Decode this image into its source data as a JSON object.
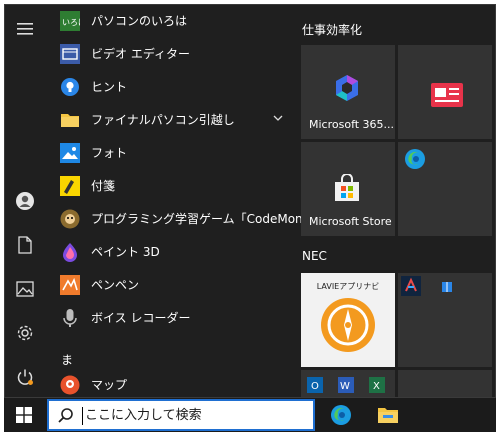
{
  "apps": [
    {
      "label": "パソコンのいろは"
    },
    {
      "label": "ビデオ エディター"
    },
    {
      "label": "ヒント"
    },
    {
      "label": "ファイナルパソコン引越し"
    },
    {
      "label": "フォト"
    },
    {
      "label": "付箋"
    },
    {
      "label": "プログラミング学習ゲーム「CodeMonkey（…"
    },
    {
      "label": "ペイント 3D"
    },
    {
      "label": "ペンペン"
    },
    {
      "label": "ボイス レコーダー"
    },
    {
      "label": "マップ"
    }
  ],
  "section_letter": "ま",
  "tile_groups": [
    {
      "title": "仕事効率化"
    },
    {
      "title": "NEC"
    }
  ],
  "tiles": {
    "microsoft365": "Microsoft 365...",
    "store": "Microsoft Store",
    "lavie": "LAVIEアプリナビ"
  },
  "search": {
    "placeholder": "ここに入力して検索"
  },
  "colors": {
    "menu_bg": "#1f1f1f",
    "tile_bg": "#2f2f2f",
    "lavie_orange": "#f39a1f",
    "search_border": "#1f6fd1"
  },
  "icons": {
    "rail": [
      "hamburger-icon",
      "user-icon",
      "document-icon",
      "pictures-icon",
      "settings-icon",
      "power-icon"
    ],
    "taskbar": [
      "windows-icon",
      "search-icon",
      "edge-icon",
      "file-explorer-icon"
    ]
  }
}
